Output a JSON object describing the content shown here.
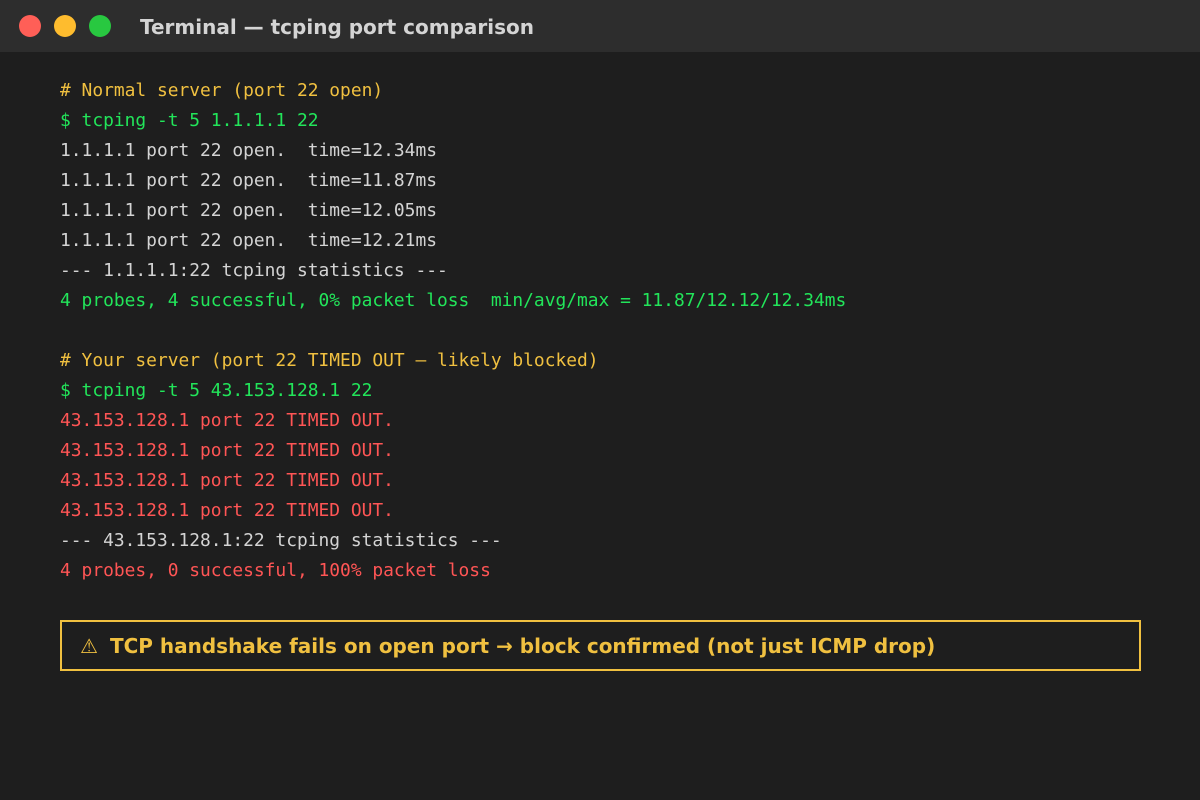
{
  "window": {
    "title": "Terminal — tcping port comparison"
  },
  "colors": {
    "close": "#ff5f57",
    "minimize": "#febc2e",
    "zoom": "#28c840",
    "comment": "#f0c040",
    "command": "#22e55a",
    "output": "#d4d4d4",
    "error": "#ff5555",
    "warning": "#f0c040"
  },
  "terminal": {
    "lines": [
      {
        "text": "# Normal server (port 22 open)",
        "kind": "comment"
      },
      {
        "text": "$ tcping -t 5 1.1.1.1 22",
        "kind": "command"
      },
      {
        "text": "1.1.1.1 port 22 open.  time=12.34ms",
        "kind": "output"
      },
      {
        "text": "1.1.1.1 port 22 open.  time=11.87ms",
        "kind": "output"
      },
      {
        "text": "1.1.1.1 port 22 open.  time=12.05ms",
        "kind": "output"
      },
      {
        "text": "1.1.1.1 port 22 open.  time=12.21ms",
        "kind": "output"
      },
      {
        "text": "--- 1.1.1.1:22 tcping statistics ---",
        "kind": "output"
      },
      {
        "text": "4 probes, 4 successful, 0% packet loss  min/avg/max = 11.87/12.12/12.34ms",
        "kind": "command"
      },
      {
        "text": "",
        "kind": "blank"
      },
      {
        "text": "# Your server (port 22 TIMED OUT — likely blocked)",
        "kind": "comment"
      },
      {
        "text": "$ tcping -t 5 43.153.128.1 22",
        "kind": "command"
      },
      {
        "text": "43.153.128.1 port 22 TIMED OUT.",
        "kind": "error"
      },
      {
        "text": "43.153.128.1 port 22 TIMED OUT.",
        "kind": "error"
      },
      {
        "text": "43.153.128.1 port 22 TIMED OUT.",
        "kind": "error"
      },
      {
        "text": "43.153.128.1 port 22 TIMED OUT.",
        "kind": "error"
      },
      {
        "text": "--- 43.153.128.1:22 tcping statistics ---",
        "kind": "output"
      },
      {
        "text": "4 probes, 0 successful, 100% packet loss",
        "kind": "error"
      }
    ]
  },
  "warning": {
    "icon": "warning-icon",
    "icon_glyph": "⚠",
    "text": "TCP handshake fails on open port → block confirmed (not just ICMP drop)"
  }
}
